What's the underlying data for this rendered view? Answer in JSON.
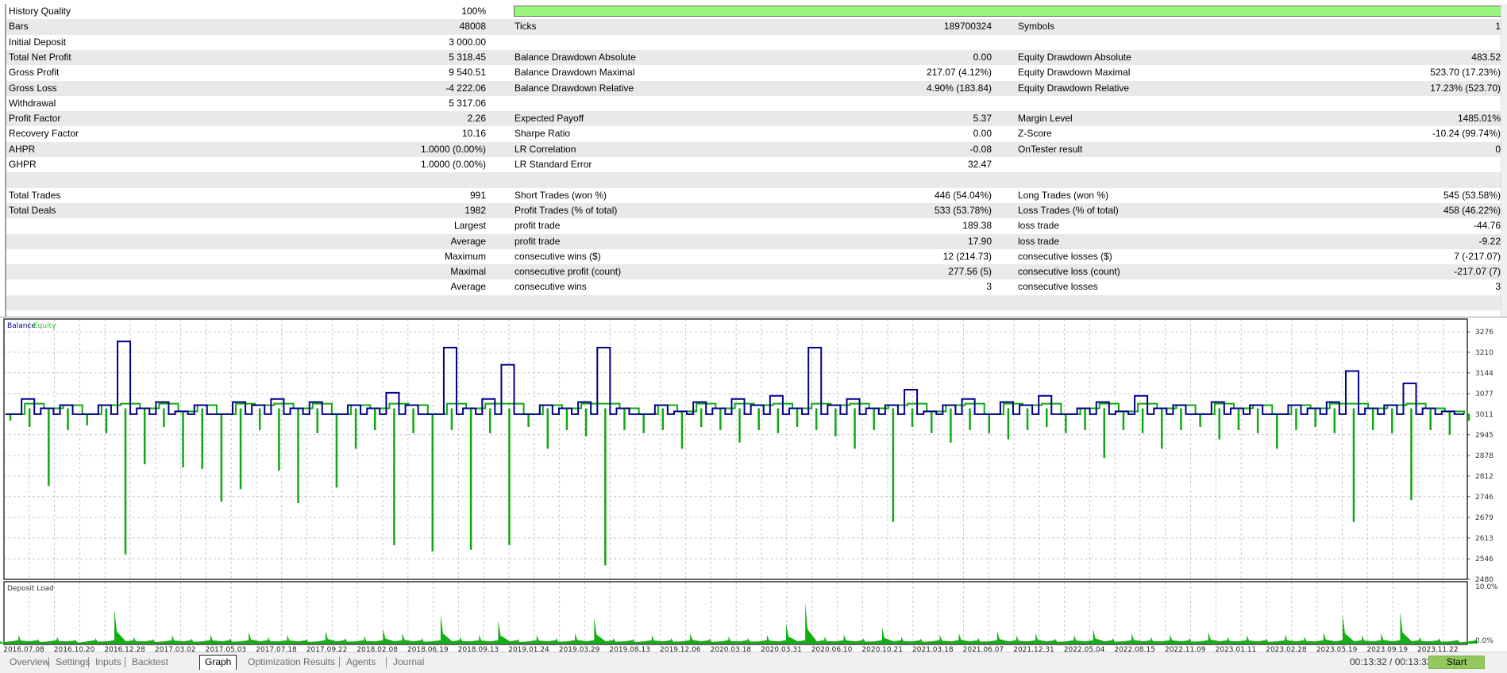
{
  "report": {
    "rows": [
      {
        "l1": "History Quality",
        "v1": "100%",
        "l2": "",
        "v2": "",
        "l3": "",
        "v3": "",
        "quality_bar": 100
      },
      {
        "l1": "Bars",
        "v1": "48008",
        "l2": "Ticks",
        "v2": "189700324",
        "l3": "Symbols",
        "v3": "1"
      },
      {
        "l1": "Initial Deposit",
        "v1": "3 000.00",
        "l2": "",
        "v2": "",
        "l3": "",
        "v3": ""
      },
      {
        "l1": "Total Net Profit",
        "v1": "5 318.45",
        "l2": "Balance Drawdown Absolute",
        "v2": "0.00",
        "l3": "Equity Drawdown Absolute",
        "v3": "483.52"
      },
      {
        "l1": "Gross Profit",
        "v1": "9 540.51",
        "l2": "Balance Drawdown Maximal",
        "v2": "217.07 (4.12%)",
        "l3": "Equity Drawdown Maximal",
        "v3": "523.70 (17.23%)"
      },
      {
        "l1": "Gross Loss",
        "v1": "-4 222.06",
        "l2": "Balance Drawdown Relative",
        "v2": "4.90% (183.84)",
        "l3": "Equity Drawdown Relative",
        "v3": "17.23% (523.70)"
      },
      {
        "l1": "Withdrawal",
        "v1": "5 317.06",
        "l2": "",
        "v2": "",
        "l3": "",
        "v3": ""
      },
      {
        "l1": "Profit Factor",
        "v1": "2.26",
        "l2": "Expected Payoff",
        "v2": "5.37",
        "l3": "Margin Level",
        "v3": "1485.01%"
      },
      {
        "l1": "Recovery Factor",
        "v1": "10.16",
        "l2": "Sharpe Ratio",
        "v2": "0.00",
        "l3": "Z-Score",
        "v3": "-10.24 (99.74%)"
      },
      {
        "l1": "AHPR",
        "v1": "1.0000 (0.00%)",
        "l2": "LR Correlation",
        "v2": "-0.08",
        "l3": "OnTester result",
        "v3": "0"
      },
      {
        "l1": "GHPR",
        "v1": "1.0000 (0.00%)",
        "l2": "LR Standard Error",
        "v2": "32.47",
        "l3": "",
        "v3": ""
      },
      {
        "l1": "",
        "v1": "",
        "l2": "",
        "v2": "",
        "l3": "",
        "v3": ""
      },
      {
        "l1": "Total Trades",
        "v1": "991",
        "l2": "Short Trades (won %)",
        "v2": "446 (54.04%)",
        "l3": "Long Trades (won %)",
        "v3": "545 (53.58%)"
      },
      {
        "l1": "Total Deals",
        "v1": "1982",
        "l2": "Profit Trades (% of total)",
        "v2": "533 (53.78%)",
        "l3": "Loss Trades (% of total)",
        "v3": "458 (46.22%)"
      },
      {
        "l1": "",
        "v1": "Largest",
        "l2": "profit trade",
        "v2": "189.38",
        "l3": "loss trade",
        "v3": "-44.76"
      },
      {
        "l1": "",
        "v1": "Average",
        "l2": "profit trade",
        "v2": "17.90",
        "l3": "loss trade",
        "v3": "-9.22"
      },
      {
        "l1": "",
        "v1": "Maximum",
        "l2": "consecutive wins ($)",
        "v2": "12 (214.73)",
        "l3": "consecutive losses ($)",
        "v3": "7 (-217.07)"
      },
      {
        "l1": "",
        "v1": "Maximal",
        "l2": "consecutive profit (count)",
        "v2": "277.56 (5)",
        "l3": "consecutive loss (count)",
        "v3": "-217.07 (7)"
      },
      {
        "l1": "",
        "v1": "Average",
        "l2": "consecutive wins",
        "v2": "3",
        "l3": "consecutive losses",
        "v3": "3"
      },
      {
        "l1": "",
        "v1": "",
        "l2": "",
        "v2": "",
        "l3": "",
        "v3": ""
      }
    ]
  },
  "chart_data": [
    {
      "type": "line",
      "legend": {
        "balance": "Balance",
        "separator": " / ",
        "equity": "Equity"
      },
      "colors": {
        "balance": "#00008b",
        "equity": "#10a810",
        "grid": "#c8c8c8"
      },
      "ylim": [
        2480,
        3317
      ],
      "y_ticks": [
        "3276",
        "3210",
        "3144",
        "3077",
        "3011",
        "2945",
        "2878",
        "2812",
        "2746",
        "2679",
        "2613",
        "2546",
        "2480"
      ],
      "x_tick_labels": [
        "2016.07.08",
        "2016.10.20",
        "2016.12.28",
        "2017.03.02",
        "2017.05.03",
        "2017.07.18",
        "2017.09.22",
        "2018.02.08",
        "2018.06.19",
        "2018.09.13",
        "2019.01.24",
        "2019.03.29",
        "2019.08.13",
        "2019.12.06",
        "2020.03.18",
        "2020.03.31",
        "2020.06.10",
        "2020.10.21",
        "2021.03.18",
        "2021.06.07",
        "2021.12.31",
        "2022.05.04",
        "2022.08.15",
        "2022.11.09",
        "2023.01.11",
        "2023.02.28",
        "2023.05.19",
        "2023.09.19",
        "2023.11.22"
      ],
      "series": [
        {
          "name": "Balance",
          "values": [
            3011,
            3060,
            3030,
            3040,
            3011,
            3040,
            3245,
            3030,
            3050,
            3020,
            3040,
            3011,
            3050,
            3040,
            3060,
            3030,
            3050,
            3011,
            3040,
            3030,
            3080,
            3040,
            3011,
            3225,
            3030,
            3060,
            3170,
            3011,
            3040,
            3030,
            3050,
            3225,
            3030,
            3011,
            3040,
            3020,
            3050,
            3030,
            3060,
            3040,
            3070,
            3030,
            3225,
            3040,
            3060,
            3030,
            3040,
            3090,
            3020,
            3040,
            3060,
            3011,
            3050,
            3040,
            3070,
            3011,
            3030,
            3050,
            3020,
            3070,
            3030,
            3040,
            3011,
            3050,
            3030,
            3040,
            3011,
            3040,
            3030,
            3050,
            3150,
            3030,
            3040,
            3110,
            3030,
            3020,
            3011
          ]
        },
        {
          "name": "Equity",
          "values": [
            2990,
            2970,
            2780,
            2960,
            2975,
            2950,
            2560,
            2850,
            2970,
            2840,
            2835,
            2730,
            2770,
            2960,
            2830,
            2725,
            2950,
            2775,
            2900,
            2960,
            2590,
            2950,
            2570,
            2960,
            2575,
            2950,
            2590,
            2970,
            2900,
            2960,
            2940,
            2525,
            2960,
            2950,
            2960,
            2900,
            2970,
            2960,
            2920,
            2960,
            2950,
            2970,
            2960,
            2940,
            2900,
            2960,
            2665,
            2970,
            2950,
            2920,
            2960,
            2950,
            2930,
            2960,
            2970,
            2950,
            2960,
            2870,
            2960,
            2950,
            2900,
            2960,
            2970,
            2930,
            2960,
            2950,
            2900,
            2960,
            2970,
            2950,
            2665,
            2960,
            2950,
            2735,
            2960,
            2945,
            2990
          ]
        }
      ]
    },
    {
      "type": "area",
      "title": "Deposit Load",
      "ylim": [
        0,
        10
      ],
      "y_ticks": [
        "10.0%",
        "0.0%"
      ],
      "unit": "%",
      "values": [
        0.6,
        1.5,
        0.8,
        1.2,
        0.5,
        1.0,
        6.0,
        1.2,
        0.8,
        1.5,
        0.9,
        1.6,
        1.0,
        2.0,
        1.2,
        1.5,
        0.8,
        2.2,
        1.0,
        1.3,
        2.5,
        1.8,
        1.0,
        5.0,
        1.2,
        1.5,
        4.0,
        0.8,
        1.5,
        1.0,
        1.8,
        4.5,
        1.0,
        0.8,
        1.5,
        1.0,
        1.8,
        0.9,
        1.2,
        1.0,
        1.5,
        3.5,
        7.0,
        1.2,
        1.6,
        1.0,
        2.8,
        1.2,
        0.9,
        1.5,
        1.8,
        1.0,
        2.2,
        1.4,
        1.8,
        0.9,
        1.5,
        2.5,
        1.0,
        1.8,
        1.2,
        1.6,
        1.0,
        2.0,
        1.2,
        1.5,
        0.9,
        1.6,
        1.2,
        2.0,
        5.0,
        1.5,
        1.8,
        5.5,
        1.2,
        1.0,
        0.6
      ]
    }
  ],
  "tabs": [
    {
      "label": "Overview",
      "active": false
    },
    {
      "label": "Settings",
      "active": false
    },
    {
      "label": "Inputs",
      "active": false
    },
    {
      "label": "Backtest",
      "active": false
    },
    {
      "label": "Graph",
      "active": true
    },
    {
      "label": "Optimization Results",
      "active": false
    },
    {
      "label": "Agents",
      "active": false
    },
    {
      "label": "Journal",
      "active": false
    }
  ],
  "status": {
    "elapsed": "00:13:32 / 00:13:33",
    "start_label": "Start",
    "start_color": "#92c85f"
  }
}
